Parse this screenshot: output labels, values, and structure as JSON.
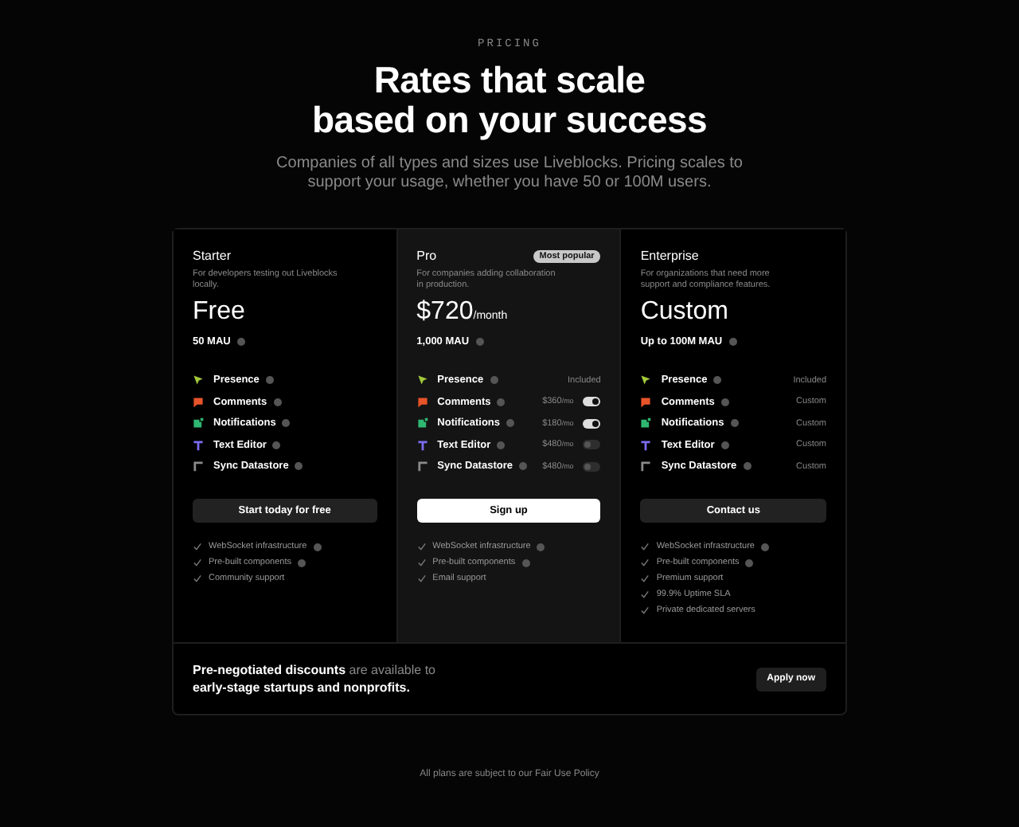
{
  "eyebrow": "PRICING",
  "heading": [
    "Rates that scale",
    "based on your success"
  ],
  "subtitle": "Companies of all types and sizes use Liveblocks. Pricing scales to support your usage, whether you have 50 or 100M users.",
  "plans": [
    {
      "name": "Starter",
      "highlighted": false,
      "description": "For developers testing out Liveblocks locally.",
      "price": "Free",
      "mau": "50 MAU",
      "features": [
        {
          "kind": "cursor",
          "name": "Presence",
          "color": "#a3c93a"
        },
        {
          "kind": "comment",
          "name": "Comments",
          "color": "#e8542a"
        },
        {
          "kind": "bell",
          "name": "Notifications",
          "color": "#2fb872"
        },
        {
          "kind": "text",
          "name": "Text Editor",
          "color": "#7b6cf0"
        },
        {
          "kind": "sync",
          "name": "Sync Datastore",
          "color": "#8a8a8a"
        }
      ],
      "button": {
        "label": "Start today for free",
        "primary": false
      },
      "checklist": [
        {
          "text": "WebSocket infrastructure",
          "info": true
        },
        {
          "text": "Pre-built components",
          "info": true
        },
        {
          "text": "Community support",
          "info": false
        }
      ]
    },
    {
      "name": "Pro",
      "highlighted": true,
      "badge": "Most popular",
      "description": "For companies adding collaboration in production.",
      "price": "$720",
      "price_unit": "/month",
      "mau": "1,000 MAU",
      "features": [
        {
          "kind": "cursor",
          "name": "Presence",
          "color": "#a3c93a",
          "value": "Included"
        },
        {
          "kind": "comment",
          "name": "Comments",
          "color": "#e8542a",
          "value": "$360",
          "unit": "/mo",
          "on": true
        },
        {
          "kind": "bell",
          "name": "Notifications",
          "color": "#2fb872",
          "value": "$180",
          "unit": "/mo",
          "on": true
        },
        {
          "kind": "text",
          "name": "Text Editor",
          "color": "#7b6cf0",
          "value": "$480",
          "unit": "/mo",
          "on": false
        },
        {
          "kind": "sync",
          "name": "Sync Datastore",
          "color": "#8a8a8a",
          "value": "$480",
          "unit": "/mo",
          "on": false
        }
      ],
      "button": {
        "label": "Sign up",
        "primary": true
      },
      "checklist": [
        {
          "text": "WebSocket infrastructure",
          "info": true
        },
        {
          "text": "Pre-built components",
          "info": true
        },
        {
          "text": "Email support",
          "info": false
        }
      ]
    },
    {
      "name": "Enterprise",
      "highlighted": false,
      "description": "For organizations that need more support and compliance features.",
      "price": "Custom",
      "mau": "Up to 100M MAU",
      "features": [
        {
          "kind": "cursor",
          "name": "Presence",
          "color": "#a3c93a",
          "value": "Included"
        },
        {
          "kind": "comment",
          "name": "Comments",
          "color": "#e8542a",
          "value": "Custom"
        },
        {
          "kind": "bell",
          "name": "Notifications",
          "color": "#2fb872",
          "value": "Custom"
        },
        {
          "kind": "text",
          "name": "Text Editor",
          "color": "#7b6cf0",
          "value": "Custom"
        },
        {
          "kind": "sync",
          "name": "Sync Datastore",
          "color": "#8a8a8a",
          "value": "Custom"
        }
      ],
      "button": {
        "label": "Contact us",
        "primary": false
      },
      "checklist": [
        {
          "text": "WebSocket infrastructure",
          "info": true
        },
        {
          "text": "Pre-built components",
          "info": true
        },
        {
          "text": "Premium support",
          "info": false
        },
        {
          "text": "99.9% Uptime SLA",
          "info": false
        },
        {
          "text": "Private dedicated servers",
          "info": false
        }
      ]
    }
  ],
  "banner": {
    "text": "**Pre-negotiated discounts** are available to **early-stage startups and nonprofits.**",
    "button": "Apply now"
  },
  "footer": "All plans are subject to our Fair Use Policy"
}
